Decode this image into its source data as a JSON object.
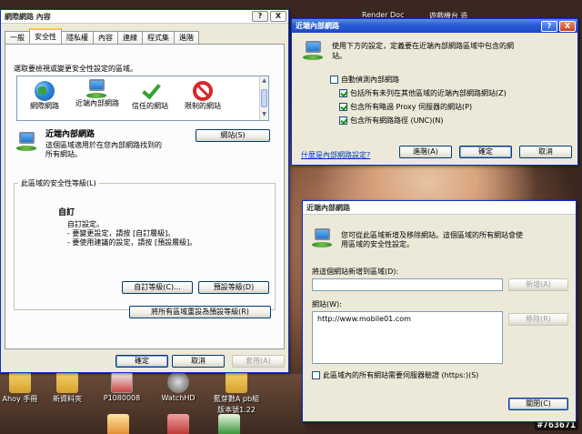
{
  "desktop": {
    "top_labels": [
      "Render Doc",
      "遊戲機台 造"
    ],
    "icons": [
      {
        "label": "Ahoy 手冊",
        "icon": "folder-icon"
      },
      {
        "label": "新資料夾",
        "icon": "folder-icon"
      },
      {
        "label": "P1080008",
        "icon": "photo-icon"
      },
      {
        "label": "WatchHD",
        "icon": "app-icon"
      },
      {
        "label": "藍芽數A pb組",
        "icon": "folder-icon"
      },
      {
        "label": "版本號1.22",
        "icon": "text"
      }
    ],
    "watermark": "#763671",
    "colors": {
      "accent": "#0831d9",
      "titlebar": "#2a5ed8",
      "face": "#ece9d8"
    }
  },
  "inet_options": {
    "title": "網際網路 內容",
    "title_buttons": [
      "?",
      "X"
    ],
    "tabs": [
      "一般",
      "安全性",
      "隱私權",
      "內容",
      "連線",
      "程式集",
      "進階"
    ],
    "active_tab": "安全性",
    "zone_prompt": "選取要檢視或變更安全性設定的區域。",
    "zones": [
      {
        "label": "網際網路",
        "icon": "globe-icon"
      },
      {
        "label": "近端內部網路",
        "icon": "local-intranet-icon"
      },
      {
        "label": "信任的網站",
        "icon": "trusted-check-icon"
      },
      {
        "label": "限制的網站",
        "icon": "restricted-icon"
      }
    ],
    "zone_name": "近端內部網路",
    "zone_desc_line1": "這個區域適用於在您內部網路找到的",
    "zone_desc_line2": "所有網站。",
    "sites_button": "網站(S)",
    "security_level_label": "此區域的安全性等級(L)",
    "level_name": "自訂",
    "level_desc": [
      "自訂設定。",
      "- 要變更設定，請按 [自訂層級]。",
      "- 要使用建議的設定，請按 [預設層級]。"
    ],
    "custom_level_button": "自訂等級(C)...",
    "default_level_button": "預設等級(D)",
    "reset_all_button": "將所有區域重設為預設等級(R)",
    "ok_button": "確定",
    "cancel_button": "取消",
    "apply_button": "套用(A)"
  },
  "intranet_settings": {
    "title": "近端內部網路",
    "title_buttons": [
      "?",
      "X"
    ],
    "intro_line1": "使用下方的設定，定義要在近端內部網路區域中包含的網",
    "intro_line2": "站。",
    "auto_detect_label": "自動偵測內部網路",
    "auto_detect_checked": false,
    "options": [
      {
        "label": "包括所有未列在其他區域的近端內部網路網站(Z)",
        "checked": true
      },
      {
        "label": "包含所有略過 Proxy 伺服器的網站(P)",
        "checked": true
      },
      {
        "label": "包含所有網路路徑 (UNC)(N)",
        "checked": true
      }
    ],
    "help_link": "什麼是內部網路設定?",
    "advanced_button": "進階(A)",
    "ok_button": "確定",
    "cancel_button": "取消"
  },
  "intranet_sites": {
    "title": "近端內部網路",
    "desc_line1": "您可從此區域新增及移除網站。這個區域的所有網站會使",
    "desc_line2": "用區域的安全性設定。",
    "add_label": "將這個網站新增到區域(D):",
    "add_value": "",
    "add_button": "新增(A)",
    "sites_label": "網站(W):",
    "sites": [
      "http://www.mobile01.com"
    ],
    "remove_button": "移除(R)",
    "require_https_label": "此區域內的所有網站需要伺服器驗證 (https:)(S)",
    "require_https_checked": false,
    "close_button": "關閉(C)"
  }
}
